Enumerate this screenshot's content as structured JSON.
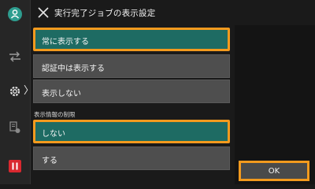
{
  "header": {
    "title": "実行完了ジョブの表示設定",
    "close_icon": "close-icon"
  },
  "sidebar": {
    "icons": [
      "account-icon",
      "transfer-icon",
      "settings-icon",
      "job-status-icon",
      "pause-icon"
    ],
    "settings_chevron": "〉",
    "pause_color": "#d9282f"
  },
  "display_options": [
    {
      "label": "常に表示する",
      "selected": true
    },
    {
      "label": "認証中は表示する",
      "selected": false
    },
    {
      "label": "表示しない",
      "selected": false
    }
  ],
  "restriction": {
    "section_label": "表示情報の制限",
    "options": [
      {
        "label": "しない",
        "selected": true
      },
      {
        "label": "する",
        "selected": false
      }
    ]
  },
  "footer": {
    "ok_label": "OK"
  },
  "colors": {
    "selected_background": "#1e6b63",
    "focus_border": "#f39a1e",
    "option_background": "#4e4e4e"
  }
}
